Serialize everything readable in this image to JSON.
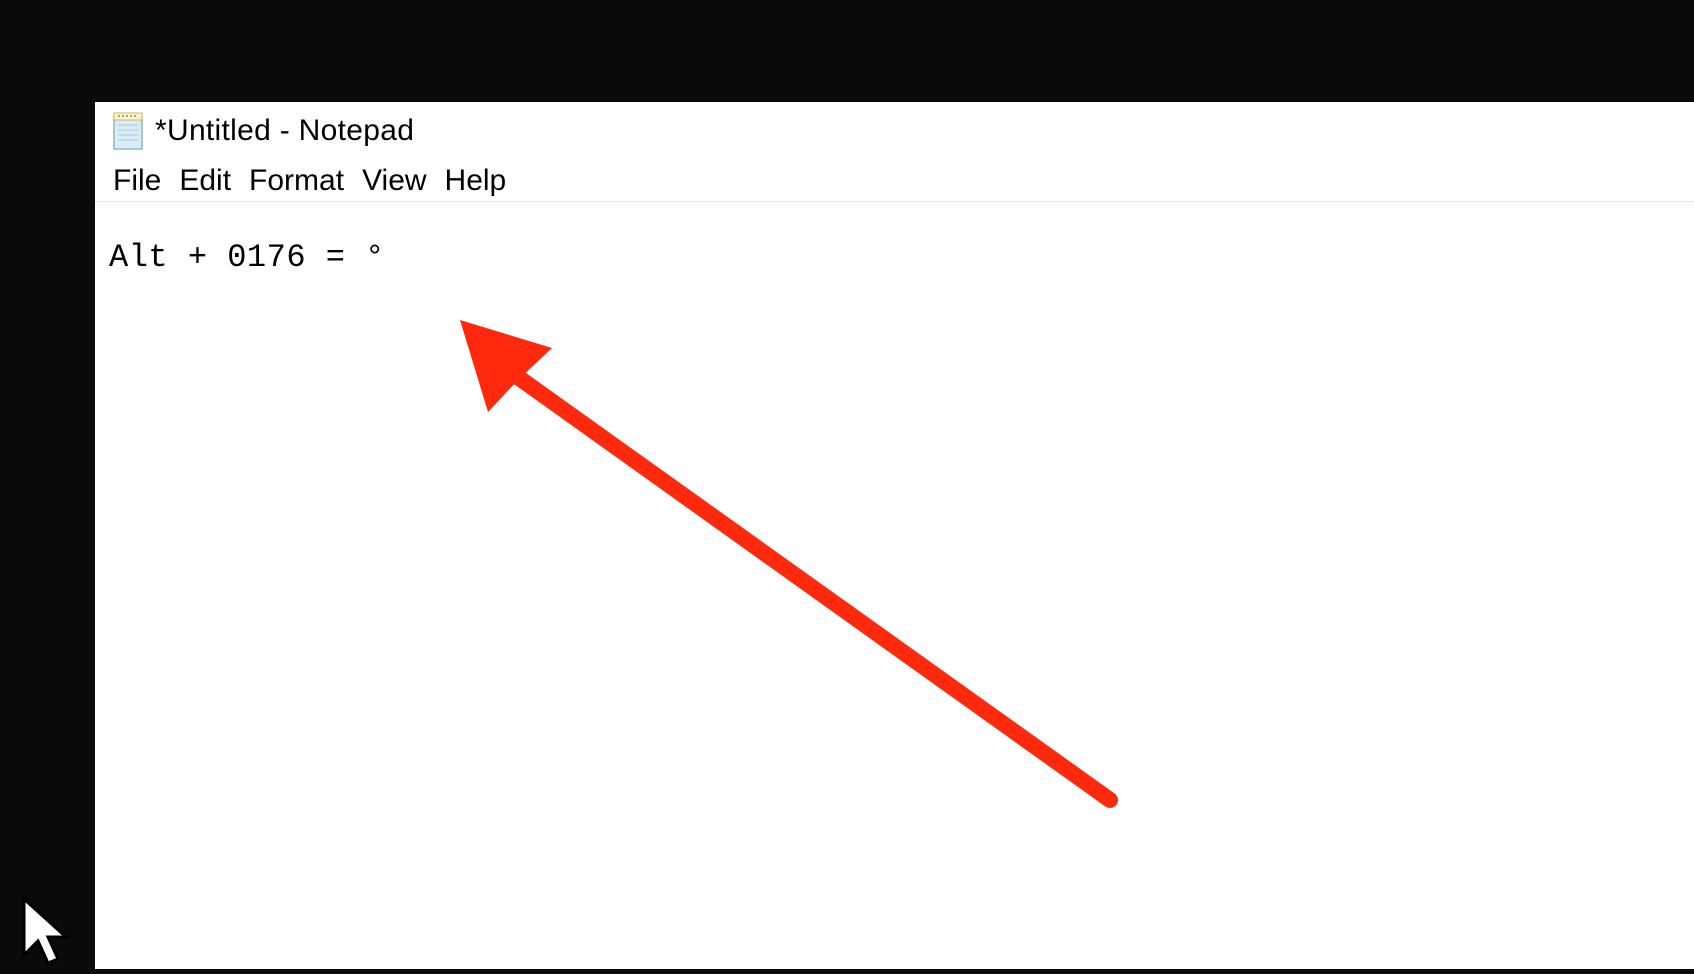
{
  "window": {
    "title": "*Untitled - Notepad"
  },
  "menu": {
    "items": [
      {
        "label": "File"
      },
      {
        "label": "Edit"
      },
      {
        "label": "Format"
      },
      {
        "label": "View"
      },
      {
        "label": "Help"
      }
    ]
  },
  "editor": {
    "content": "Alt + 0176 = °"
  },
  "annotation": {
    "arrow_color": "#ff2a0e"
  }
}
